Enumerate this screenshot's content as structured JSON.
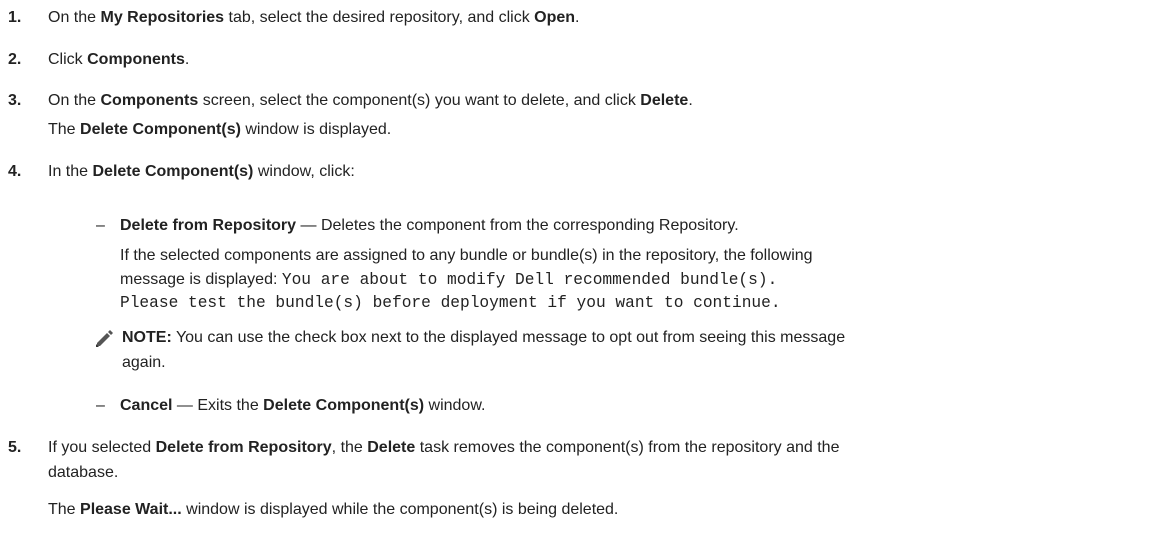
{
  "steps": [
    {
      "number": "1.",
      "parts": [
        "On the ",
        "My Repositories",
        " tab, select the desired repository, and click ",
        "Open",
        "."
      ]
    },
    {
      "number": "2.",
      "parts": [
        "Click ",
        "Components",
        "."
      ]
    },
    {
      "number": "3.",
      "parts": [
        "On the ",
        "Components",
        " screen, select the component(s) you want to delete, and click ",
        "Delete",
        "."
      ],
      "followup": [
        "The ",
        "Delete Component(s)",
        " window is displayed."
      ]
    },
    {
      "number": "4.",
      "parts": [
        "In the ",
        "Delete Component(s)",
        " window, click:"
      ]
    },
    {
      "number": "5.",
      "line1": [
        "If you selected ",
        "Delete from Repository",
        ", the ",
        "Delete",
        " task removes the component(s) from the repository and the"
      ],
      "line2": "database.",
      "followup": [
        "The ",
        "Please Wait...",
        " window is displayed while the component(s) is being deleted."
      ]
    }
  ],
  "options": [
    {
      "dash": "–",
      "label": "Delete from Repository",
      "desc": " — Deletes the component from the corresponding Repository.",
      "detail_line1": "If the selected components are assigned to any bundle or bundle(s) in the repository, the following",
      "detail_line2_prefix": "message is displayed: ",
      "message_line1": "You are about to modify Dell recommended bundle(s).",
      "message_line2": "Please test the bundle(s) before deployment if you want to continue."
    },
    {
      "dash": "–",
      "label": "Cancel",
      "desc_prefix": " — Exits the ",
      "desc_bold": "Delete Component(s)",
      "desc_suffix": " window."
    }
  ],
  "note": {
    "icon": "pencil-note-icon",
    "label": "NOTE:",
    "line1": " You can use the check box next to the displayed message to opt out from seeing this message",
    "line2": "again."
  }
}
